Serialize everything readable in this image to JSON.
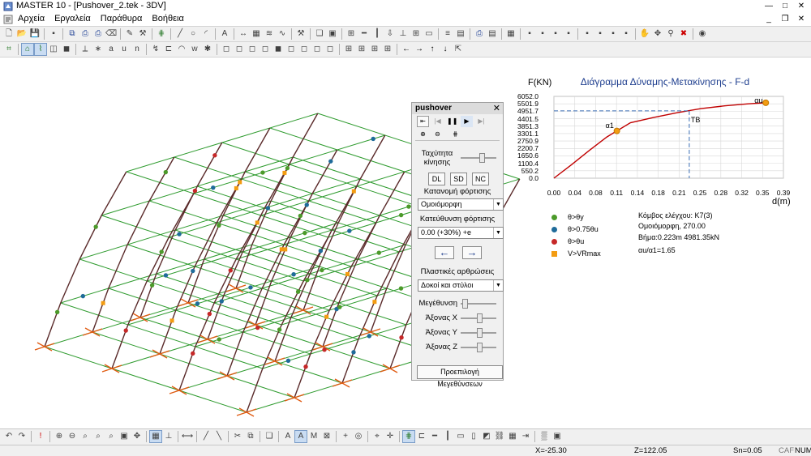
{
  "window": {
    "title": "MASTER 10 - [Pushover_2.tek - 3DV]",
    "controls": [
      "—",
      "□",
      "✕"
    ],
    "mdi_controls": [
      "_",
      "❐",
      "✕"
    ]
  },
  "menubar": {
    "items": [
      "Αρχεία",
      "Εργαλεία",
      "Παράθυρα",
      "Βοήθεια"
    ]
  },
  "toolbar1": {
    "icons": [
      "new-icon",
      "open-icon",
      "save-icon",
      "sep",
      "tree-icon",
      "sep",
      "copy-icon",
      "print-icon",
      "print-preview-icon",
      "eraser-icon",
      "sep",
      "pencil-icon",
      "tools-icon",
      "sep",
      "grid-icon",
      "sep",
      "line-icon",
      "circle-icon",
      "arc-icon",
      "sep",
      "text-icon",
      "sep",
      "dimension-icon",
      "hatch-icon",
      "pattern-icon",
      "wave-icon",
      "sep",
      "hammer-icon",
      "sep",
      "layers-icon",
      "view-icon",
      "sep",
      "frame-icon",
      "beam-icon",
      "column-icon",
      "load-icon",
      "support-icon",
      "mesh-icon",
      "slab-icon",
      "sep",
      "rebar-icon",
      "table-icon",
      "sep",
      "print-all-icon",
      "report-icon",
      "sep",
      "calc-icon",
      "sep",
      "col-a-icon",
      "col-b-icon",
      "col-c-icon",
      "col-d-icon",
      "sep",
      "frame-a-icon",
      "frame-b-icon",
      "frame-c-icon",
      "frame-d-icon",
      "sep",
      "hand-icon",
      "move-icon",
      "walker-icon",
      "delete-icon",
      "sep",
      "paint-icon"
    ]
  },
  "toolbar2": {
    "icons": [
      "select-icon",
      "sep",
      "model-icon",
      "graph-icon",
      "cube-icon",
      "color-cube-icon",
      "sep",
      "axes-icon",
      "node-icon",
      "ax-icon",
      "au-icon",
      "ne-icon",
      "sep",
      "deformed-icon",
      "section-icon",
      "moment-icon",
      "aw-icon",
      "node2-icon",
      "sep",
      "box-icon",
      "box2-icon",
      "box3-icon",
      "box4-icon",
      "box5-icon",
      "box6-icon",
      "box7-icon",
      "box8-icon",
      "box9-icon",
      "sep",
      "frame-view-icon",
      "frame-view2-icon",
      "frame-view3-icon",
      "frame-view4-icon",
      "sep",
      "arrow-left-icon",
      "arrow-right-icon",
      "arrow-up-icon",
      "arrow-down-icon",
      "export-icon"
    ]
  },
  "pushover_panel": {
    "title": "pushover",
    "close": "✕",
    "speed_label": "Ταχύτητα κίνησης",
    "dl_label": "DL",
    "sd_label": "SD",
    "nc_label": "NC",
    "distribution_label": "Κατανομή φόρτισης",
    "distribution_value": "Ομοιόμορφη",
    "direction_label": "Κατεύθυνση φόρτισης",
    "direction_value": "0.00 (+30%) +e",
    "hinges_label": "Πλαστικές αρθρώσεις",
    "hinges_value": "Δοκοί και στύλοι",
    "size_label": "Μεγέθυνση",
    "axis_x_label": "Άξονας X",
    "axis_y_label": "Άξονας Y",
    "axis_z_label": "Άξονας Z",
    "default_sizes_label": "Προεπιλογή Μεγεθύνσεων"
  },
  "chart_data": {
    "type": "line",
    "title": "Διάγραμμα Δύναμης-Μετακίνησης - F-d",
    "xlabel": "d(m)",
    "ylabel": "F(KN)",
    "xlim": [
      0,
      0.39
    ],
    "ylim": [
      0,
      6052
    ],
    "x_ticks": [
      "0.00",
      "0.04",
      "0.08",
      "0.11",
      "0.14",
      "0.18",
      "0.21",
      "0.25",
      "0.28",
      "0.32",
      "0.35",
      "0.39"
    ],
    "y_ticks": [
      "6052.0",
      "5501.9",
      "4951.7",
      "4401.5",
      "3851.3",
      "3301.1",
      "2750.9",
      "2200.7",
      "1650.6",
      "1100.4",
      "550.2",
      "0.0"
    ],
    "series": [
      {
        "x": [
          0.0,
          0.03,
          0.06,
          0.09,
          0.107,
          0.13,
          0.17,
          0.21,
          0.25,
          0.29,
          0.33,
          0.36
        ],
        "y": [
          0,
          1000,
          2050,
          3050,
          3500,
          4100,
          4500,
          4850,
          5150,
          5350,
          5500,
          5580
        ]
      }
    ],
    "markers": [
      {
        "label": "α1",
        "x": 0.107,
        "y": 3500
      },
      {
        "label": "αu",
        "x": 0.36,
        "y": 5580
      }
    ],
    "target": {
      "label": "TB",
      "x": 0.23,
      "y": 4981
    }
  },
  "legend": [
    {
      "label": "θ>θy",
      "color": "#4c9a2a",
      "shape": "dot"
    },
    {
      "label": "θ>0.75θu",
      "color": "#1f6b9a",
      "shape": "dot"
    },
    {
      "label": "θ>θu",
      "color": "#c62828",
      "shape": "dot"
    },
    {
      "label": "V>VRmax",
      "color": "#f39c12",
      "shape": "square"
    }
  ],
  "info": {
    "control_node": "Κόμβος ελέγχου: K7(3)",
    "distribution": "Ομοιόμορφη, 270.00",
    "step": "Βήμα:0.223m 4981.35kN",
    "ratio": "αu/α1=1.65"
  },
  "bottom_toolbar": {
    "icons": [
      "undo-icon",
      "redo-icon",
      "sep",
      "alert-icon",
      "sep",
      "zoom-in-icon",
      "zoom-out-icon",
      "zoom-window-icon",
      "zoom-extents-icon",
      "zoom-all-icon",
      "fit-icon",
      "pan-icon",
      "sep",
      "snap-icon",
      "ortho-icon",
      "sep",
      "measure-icon",
      "sep",
      "line2-icon",
      "line3-icon",
      "sep",
      "trim-icon",
      "offset-icon",
      "sep",
      "layer-icon",
      "sep",
      "text-a-icon",
      "text-b-icon",
      "text-c-icon",
      "text-d-icon",
      "sep",
      "plus-icon",
      "target-icon",
      "sep",
      "mouse-icon",
      "crosshair-icon",
      "sep",
      "grid2-icon",
      "dim2-icon",
      "beam2-icon",
      "col2-icon",
      "slab2-icon",
      "wall2-icon",
      "fill-icon",
      "link-icon",
      "hatch2-icon",
      "end-icon",
      "sep",
      "shade-icon",
      "final-icon"
    ]
  },
  "status": {
    "x": "X=-25.30",
    "z": "Z=122.05",
    "sn": "Sn=0.05",
    "caf": "CAF",
    "num": "NUM"
  },
  "colors": {
    "accent_title": "#1f3f8f",
    "curve": "#c00000",
    "grid_green": "#2e9b2e",
    "column": "#5a2a2a",
    "support": "#e05a10"
  }
}
